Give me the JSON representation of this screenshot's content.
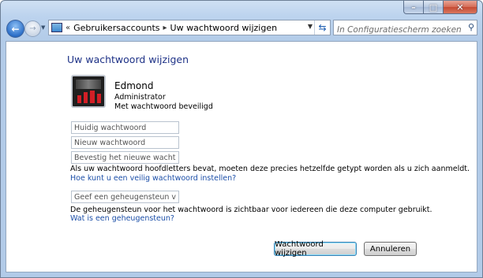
{
  "window": {
    "controls": [
      "minimize-icon",
      "maximize-icon",
      "close-icon"
    ],
    "control_glyphs": [
      "–",
      "□",
      "✕"
    ]
  },
  "navigation": {
    "back_glyph": "←",
    "forward_glyph": "→",
    "breadcrumb_prefix": "«",
    "breadcrumb": [
      "Gebruikersaccounts",
      "Uw wachtwoord wijzigen"
    ],
    "breadcrumb_sep": "▸",
    "search_placeholder": "In Configuratiescherm zoeken"
  },
  "page": {
    "title": "Uw wachtwoord wijzigen"
  },
  "user": {
    "name": "Edmond",
    "role": "Administrator",
    "protection": "Met wachtwoord beveiligd"
  },
  "form": {
    "current_password_placeholder": "Huidig wachtwoord",
    "new_password_placeholder": "Nieuw wachtwoord",
    "confirm_password_placeholder": "Bevestig het nieuwe wachtwoord",
    "case_note": "Als uw wachtwoord hoofdletters bevat, moeten deze precies hetzelfde getypt worden als u zich aanmeldt.",
    "secure_password_link": "Hoe kunt u een veilig wachtwoord instellen?",
    "hint_placeholder": "Geef een geheugensteun voor het wachtwoord op",
    "hint_note": "De geheugensteun voor het wachtwoord is zichtbaar voor iedereen die deze computer gebruikt.",
    "hint_link": "Wat is een geheugensteun?"
  },
  "buttons": {
    "change_password": "Wachtwoord wijzigen",
    "cancel": "Annuleren"
  },
  "colors": {
    "title": "#1e3287",
    "link": "#1c4fa8",
    "close_button": "#c54a33"
  }
}
